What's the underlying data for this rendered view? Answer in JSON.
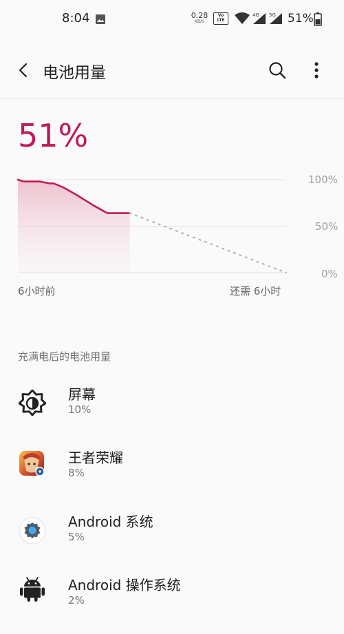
{
  "status_bar": {
    "time": "8:04",
    "net_speed_value": "0.28",
    "net_speed_unit": "KB/S",
    "volte_label": "Vo LTE",
    "net_4g": "4G",
    "net_5g": "5G",
    "battery_text": "51%"
  },
  "app_bar": {
    "title": "电池用量"
  },
  "battery": {
    "percent_label": "51%",
    "level": 51,
    "accent_color": "#c2185b"
  },
  "chart": {
    "y_labels": [
      "100%",
      "50%",
      "0%"
    ],
    "x_left_label": "6小时前",
    "x_right_label": "还需 6小时"
  },
  "chart_data": {
    "type": "line",
    "ylim": [
      0,
      100
    ],
    "xlim": [
      -6,
      6
    ],
    "x_labels": [
      "6小时前",
      "还需 6小时"
    ],
    "series": [
      {
        "kind": "actual",
        "x": [
          -6.0,
          -5.75,
          -5.5,
          -5.25,
          -5.0,
          -4.8,
          -4.6,
          -4.4,
          -4.0,
          -3.4,
          -3.0,
          -2.6,
          -2.3,
          -2.0,
          -1.5,
          -1.0
        ],
        "y": [
          100,
          98,
          98,
          98,
          98,
          97,
          96,
          96,
          92,
          84,
          78,
          72,
          68,
          64,
          64,
          64
        ]
      },
      {
        "kind": "projected",
        "x": [
          -1.0,
          6.0
        ],
        "y": [
          64,
          0
        ]
      }
    ],
    "fill": "area-under-actual",
    "grid": true
  },
  "section": {
    "title": "充满电后的电池用量"
  },
  "usage_list": [
    {
      "name": "屏幕",
      "percent": "10%",
      "icon": "screen-brightness-icon"
    },
    {
      "name": "王者荣耀",
      "percent": "8%",
      "icon": "game-app-icon"
    },
    {
      "name": "Android 系统",
      "percent": "5%",
      "icon": "android-system-icon"
    },
    {
      "name": "Android 操作系统",
      "percent": "2%",
      "icon": "android-os-icon"
    }
  ]
}
